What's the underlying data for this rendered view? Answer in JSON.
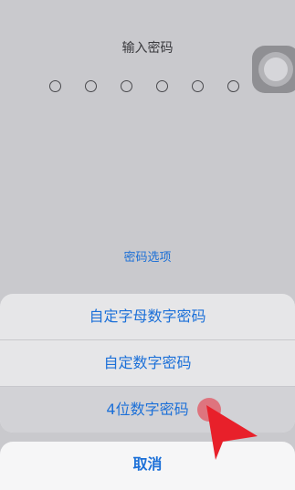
{
  "passcode": {
    "title": "输入密码",
    "digit_count": 6
  },
  "options_link": "密码选项",
  "action_sheet": {
    "items": [
      {
        "label": "自定字母数字密码"
      },
      {
        "label": "自定数字密码"
      },
      {
        "label": "4位数字密码"
      }
    ],
    "cancel_label": "取消"
  },
  "colors": {
    "accent": "#1c70d8",
    "arrow": "#e8202a"
  },
  "icons": {
    "assistive_touch": "assistive-touch-icon",
    "pointer": "red-arrow-icon"
  }
}
